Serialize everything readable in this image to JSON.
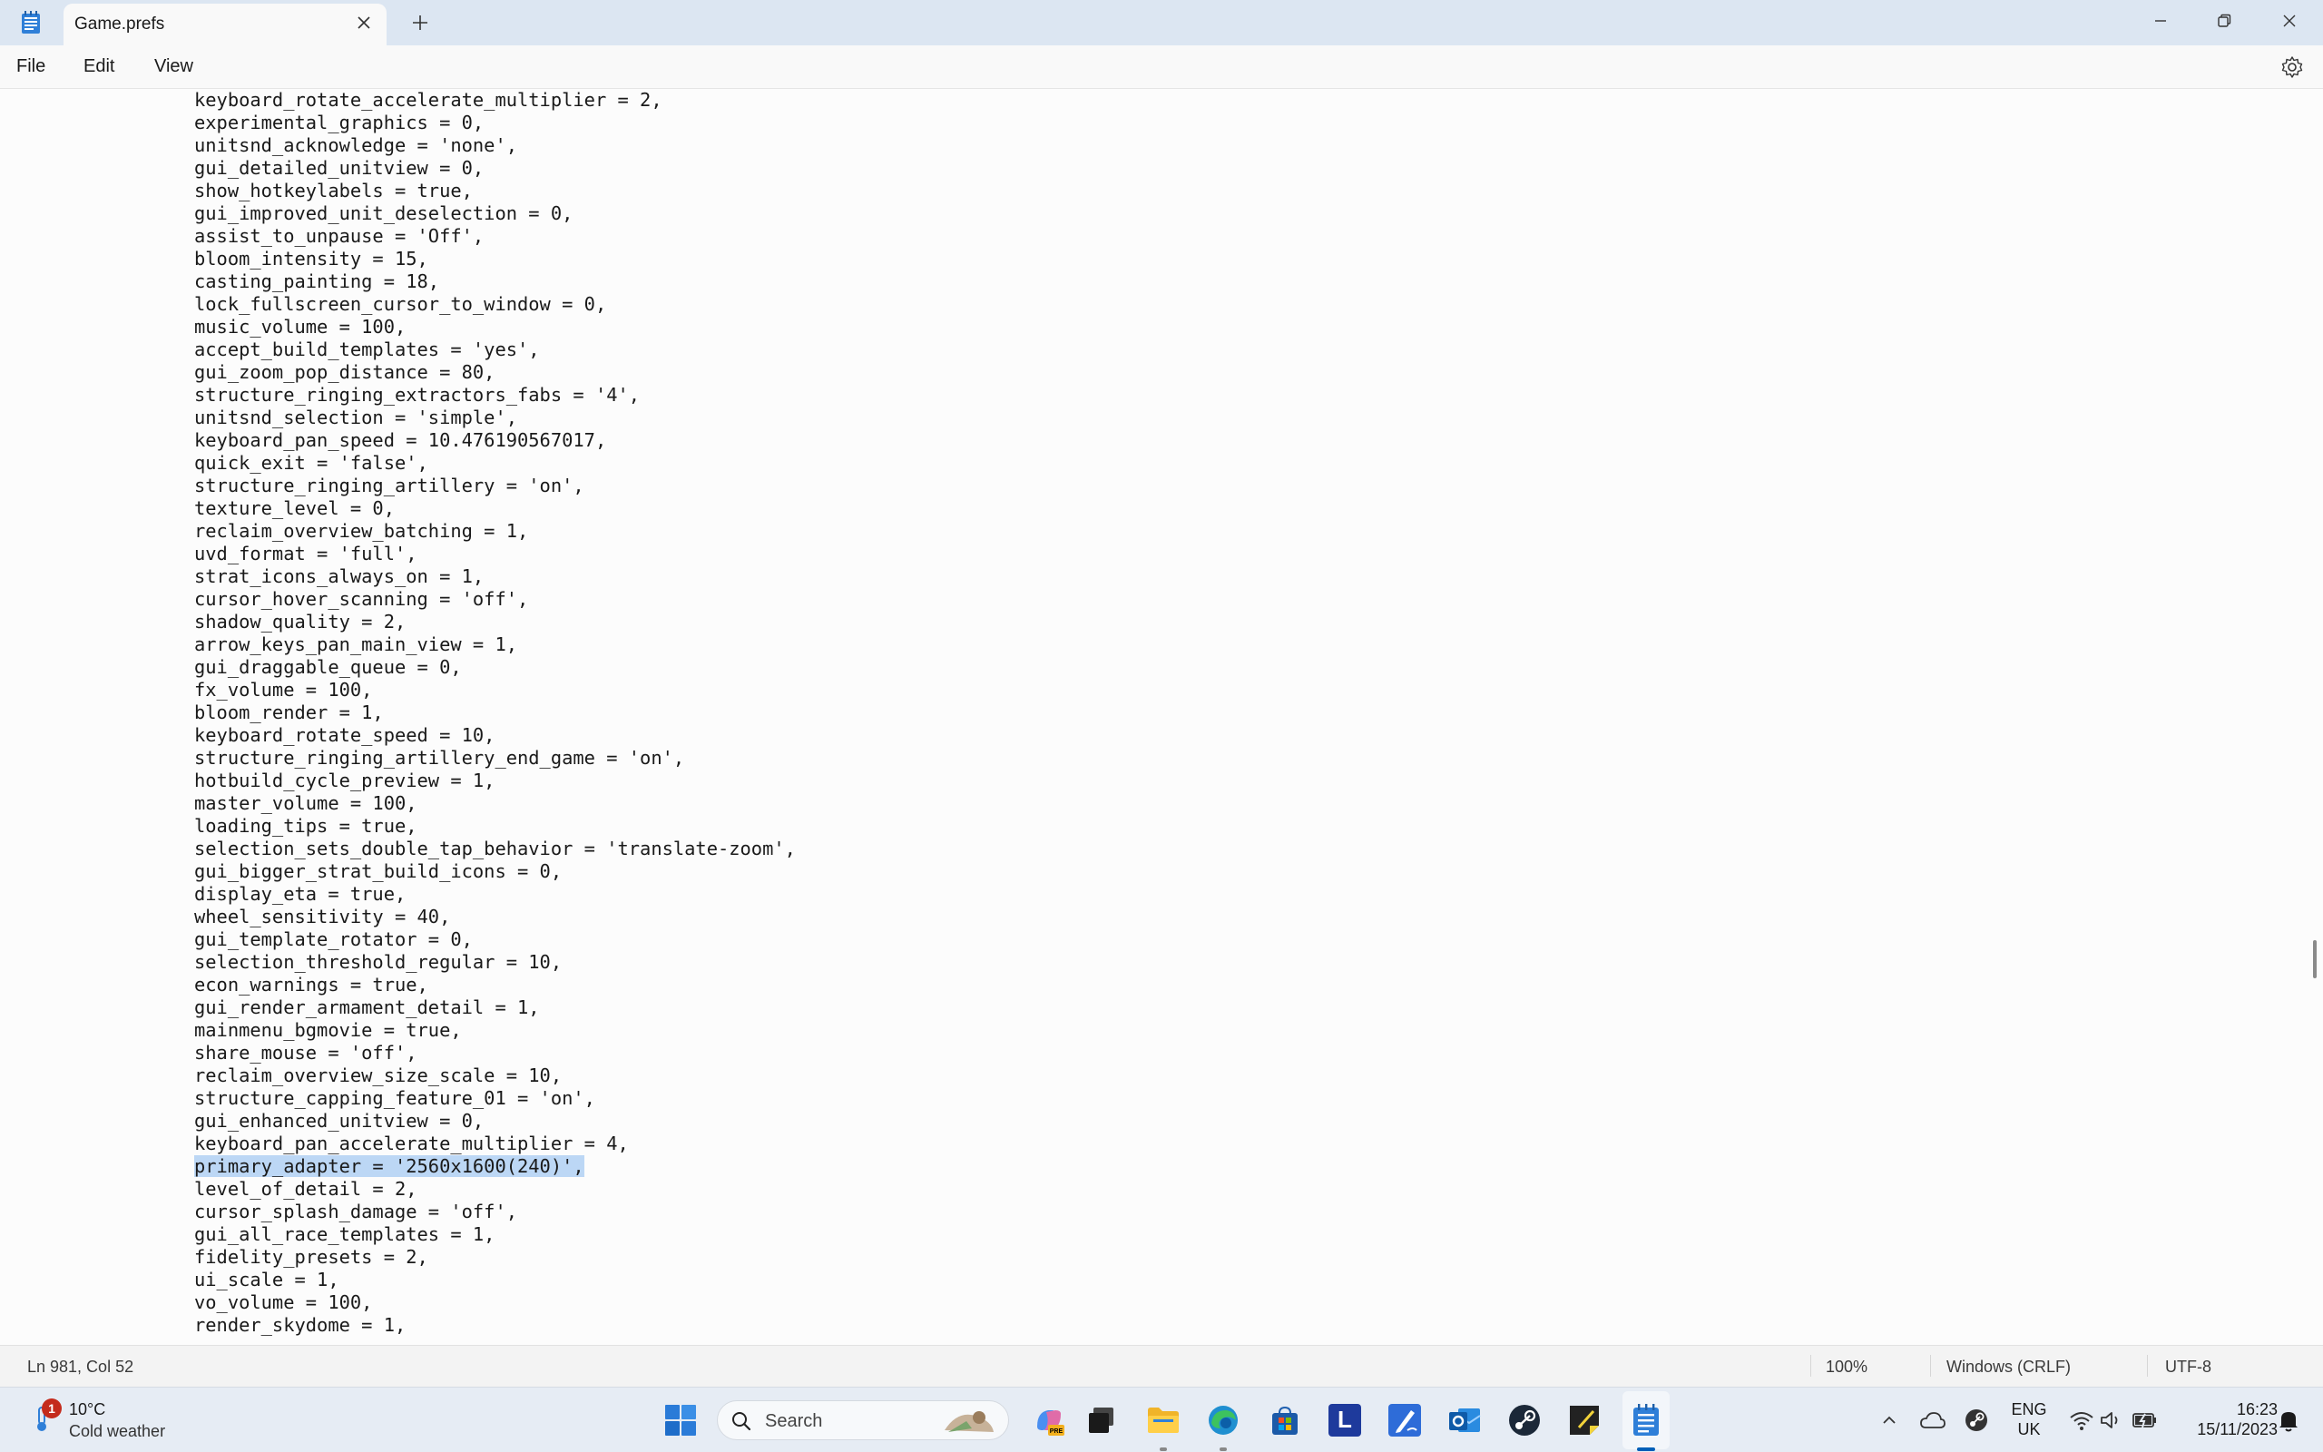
{
  "window": {
    "tab_title": "Game.prefs"
  },
  "menu": {
    "file": "File",
    "edit": "Edit",
    "view": "View"
  },
  "editor": {
    "lines": [
      "keyboard_rotate_accelerate_multiplier = 2,",
      "experimental_graphics = 0,",
      "unitsnd_acknowledge = 'none',",
      "gui_detailed_unitview = 0,",
      "show_hotkeylabels = true,",
      "gui_improved_unit_deselection = 0,",
      "assist_to_unpause = 'Off',",
      "bloom_intensity = 15,",
      "casting_painting = 18,",
      "lock_fullscreen_cursor_to_window = 0,",
      "music_volume = 100,",
      "accept_build_templates = 'yes',",
      "gui_zoom_pop_distance = 80,",
      "structure_ringing_extractors_fabs = '4',",
      "unitsnd_selection = 'simple',",
      "keyboard_pan_speed = 10.476190567017,",
      "quick_exit = 'false',",
      "structure_ringing_artillery = 'on',",
      "texture_level = 0,",
      "reclaim_overview_batching = 1,",
      "uvd_format = 'full',",
      "strat_icons_always_on = 1,",
      "cursor_hover_scanning = 'off',",
      "shadow_quality = 2,",
      "arrow_keys_pan_main_view = 1,",
      "gui_draggable_queue = 0,",
      "fx_volume = 100,",
      "bloom_render = 1,",
      "keyboard_rotate_speed = 10,",
      "structure_ringing_artillery_end_game = 'on',",
      "hotbuild_cycle_preview = 1,",
      "master_volume = 100,",
      "loading_tips = true,",
      "selection_sets_double_tap_behavior = 'translate-zoom',",
      "gui_bigger_strat_build_icons = 0,",
      "display_eta = true,",
      "wheel_sensitivity = 40,",
      "gui_template_rotator = 0,",
      "selection_threshold_regular = 10,",
      "econ_warnings = true,",
      "gui_render_armament_detail = 1,",
      "mainmenu_bgmovie = true,",
      "share_mouse = 'off',",
      "reclaim_overview_size_scale = 10,",
      "structure_capping_feature_01 = 'on',",
      "gui_enhanced_unitview = 0,",
      "keyboard_pan_accelerate_multiplier = 4,",
      "primary_adapter = '2560x1600(240)',",
      "level_of_detail = 2,",
      "cursor_splash_damage = 'off',",
      "gui_all_race_templates = 1,",
      "fidelity_presets = 2,",
      "ui_scale = 1,",
      "vo_volume = 100,",
      "render_skydome = 1,"
    ],
    "selected_line": 47
  },
  "status": {
    "position": "Ln 981, Col 52",
    "zoom": "100%",
    "line_ending": "Windows (CRLF)",
    "encoding": "UTF-8"
  },
  "taskbar": {
    "weather_temp": "10°C",
    "weather_desc": "Cold weather",
    "weather_badge": "1",
    "search_placeholder": "Search",
    "lang_top": "ENG",
    "lang_bottom": "UK",
    "time": "16:23",
    "date": "15/11/2023",
    "l_app_letter": "L"
  },
  "colors": {
    "selection": "#bcd7f5",
    "accent": "#005fb8"
  }
}
